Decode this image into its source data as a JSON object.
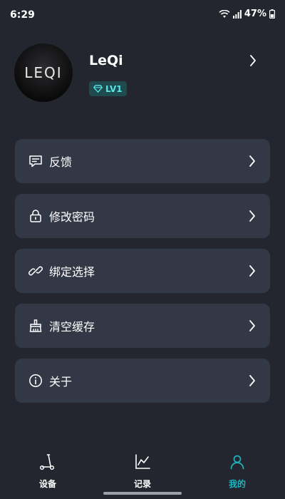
{
  "status_bar": {
    "time": "6:29",
    "battery": "47%"
  },
  "profile": {
    "avatar_logo": "LEQI",
    "name": "LeQi",
    "level": "LV1"
  },
  "menu": {
    "items": [
      {
        "label": "反馈",
        "icon": "feedback-icon"
      },
      {
        "label": "修改密码",
        "icon": "lock-icon"
      },
      {
        "label": "绑定选择",
        "icon": "link-icon"
      },
      {
        "label": "清空缓存",
        "icon": "broom-icon"
      },
      {
        "label": "关于",
        "icon": "info-icon"
      }
    ]
  },
  "bottom_nav": {
    "items": [
      {
        "label": "设备",
        "icon": "scooter-icon",
        "active": false
      },
      {
        "label": "记录",
        "icon": "chart-icon",
        "active": false
      },
      {
        "label": "我的",
        "icon": "user-icon",
        "active": true
      }
    ]
  },
  "colors": {
    "background": "#23262e",
    "card": "#333846",
    "accent": "#1fb5bd",
    "badge_bg": "#1f4b4f",
    "badge_text": "#53e6ea"
  }
}
